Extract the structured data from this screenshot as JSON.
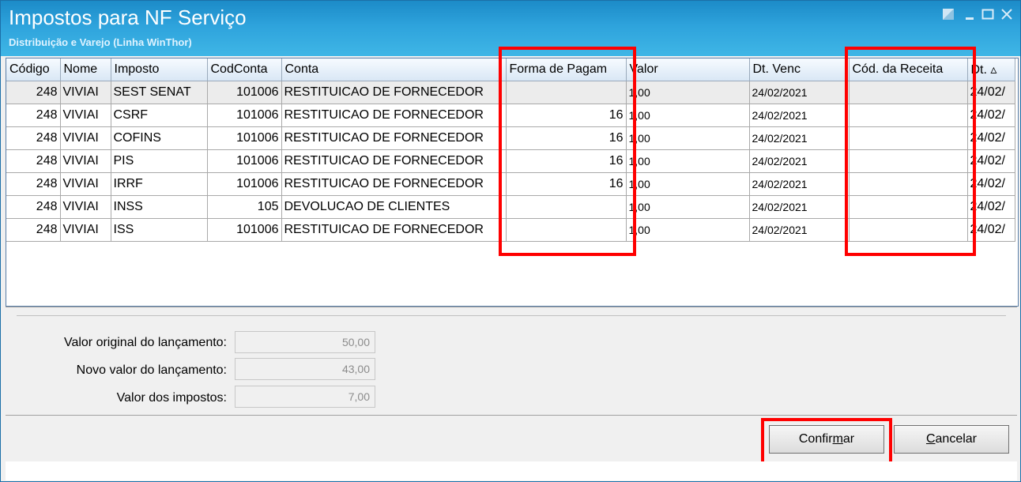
{
  "window": {
    "title": "Impostos para NF Serviço",
    "subtitle": "Distribuição e Varejo (Linha WinThor)",
    "controls": [
      "restore-icon",
      "minimize-icon",
      "maximize-icon",
      "close-icon"
    ],
    "accent_color": "#2ea3dc"
  },
  "grid": {
    "columns": [
      "Código",
      "Nome",
      "Imposto",
      "CodConta",
      "Conta",
      "Forma de Pagam",
      "Valor",
      "Dt. Venc",
      "Cód. da Receita",
      "Dt. ▵"
    ],
    "rows": [
      {
        "codigo": "248",
        "nome": "VIVIAI",
        "imposto": "SEST SENAT",
        "codconta": "101006",
        "conta": "RESTITUICAO DE FORNECEDOR",
        "forma": "",
        "valor": "1,00",
        "dtvenc": "24/02/2021",
        "receita": "",
        "dt": "24/02/"
      },
      {
        "codigo": "248",
        "nome": "VIVIAI",
        "imposto": "CSRF",
        "codconta": "101006",
        "conta": "RESTITUICAO DE FORNECEDOR",
        "forma": "16",
        "valor": "1,00",
        "dtvenc": "24/02/2021",
        "receita": "",
        "dt": "24/02/"
      },
      {
        "codigo": "248",
        "nome": "VIVIAI",
        "imposto": "COFINS",
        "codconta": "101006",
        "conta": "RESTITUICAO DE FORNECEDOR",
        "forma": "16",
        "valor": "1,00",
        "dtvenc": "24/02/2021",
        "receita": "",
        "dt": "24/02/"
      },
      {
        "codigo": "248",
        "nome": "VIVIAI",
        "imposto": "PIS",
        "codconta": "101006",
        "conta": "RESTITUICAO DE FORNECEDOR",
        "forma": "16",
        "valor": "1,00",
        "dtvenc": "24/02/2021",
        "receita": "",
        "dt": "24/02/"
      },
      {
        "codigo": "248",
        "nome": "VIVIAI",
        "imposto": "IRRF",
        "codconta": "101006",
        "conta": "RESTITUICAO DE FORNECEDOR",
        "forma": "16",
        "valor": "1,00",
        "dtvenc": "24/02/2021",
        "receita": "",
        "dt": "24/02/"
      },
      {
        "codigo": "248",
        "nome": "VIVIAI",
        "imposto": "INSS",
        "codconta": "105",
        "conta": "DEVOLUCAO DE CLIENTES",
        "forma": "",
        "valor": "1,00",
        "dtvenc": "24/02/2021",
        "receita": "",
        "dt": "24/02/"
      },
      {
        "codigo": "248",
        "nome": "VIVIAI",
        "imposto": "ISS",
        "codconta": "101006",
        "conta": "RESTITUICAO DE FORNECEDOR",
        "forma": "",
        "valor": "1,00",
        "dtvenc": "24/02/2021",
        "receita": "",
        "dt": "24/02/"
      }
    ]
  },
  "summary": {
    "valor_original_label": "Valor original do lançamento:",
    "valor_original_value": "50,00",
    "novo_valor_label": "Novo valor do lançamento:",
    "novo_valor_value": "43,00",
    "impostos_label": "Valor dos impostos:",
    "impostos_value": "7,00"
  },
  "buttons": {
    "confirm_pre": "Confir",
    "confirm_key": "m",
    "confirm_post": "ar",
    "cancel_pre": "",
    "cancel_key": "C",
    "cancel_post": "ancelar"
  },
  "highlight_color": "#ff0000"
}
